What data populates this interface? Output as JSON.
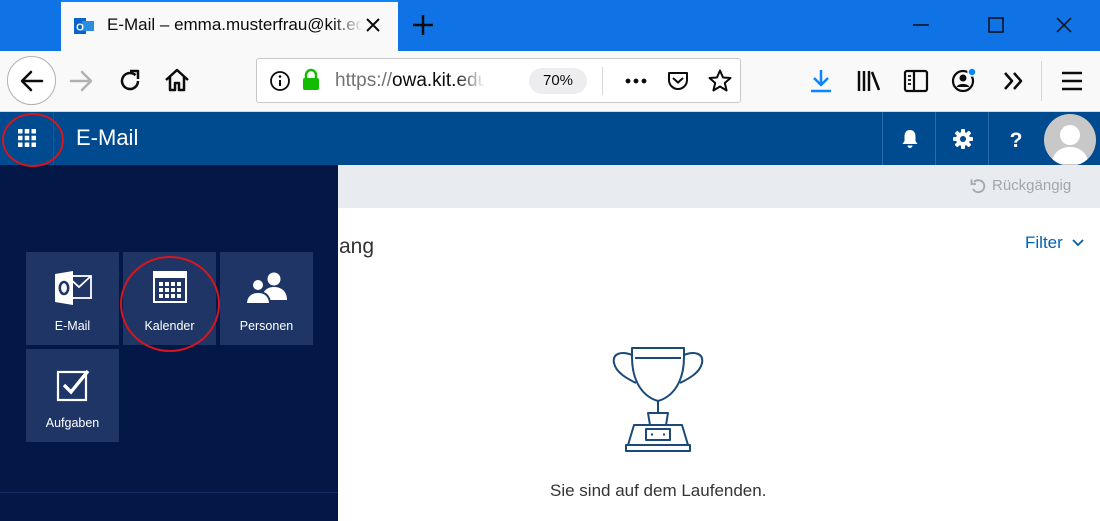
{
  "browser": {
    "tab_title": "E-Mail – emma.musterfrau@kit.edu",
    "url_scheme": "https://",
    "url_host": "owa.kit.edu",
    "zoom": "70%"
  },
  "owa": {
    "app_title": "E-Mail",
    "undo_label": "Rückgängig",
    "heading_fragment": "ang",
    "filter_label": "Filter",
    "empty_message": "Sie sind auf dem Laufenden."
  },
  "launcher": {
    "tiles": [
      {
        "label": "E-Mail",
        "icon": "outlook-mail-icon"
      },
      {
        "label": "Kalender",
        "icon": "calendar-icon"
      },
      {
        "label": "Personen",
        "icon": "people-icon"
      },
      {
        "label": "Aufgaben",
        "icon": "tasks-checkbox-icon"
      }
    ]
  },
  "colors": {
    "owa_header": "#004a8f",
    "launcher_bg": "#041848",
    "tile_bg": "#1e3566",
    "annotation": "#d6161c",
    "link": "#0063b1",
    "browser_accent": "#0a84ff"
  }
}
